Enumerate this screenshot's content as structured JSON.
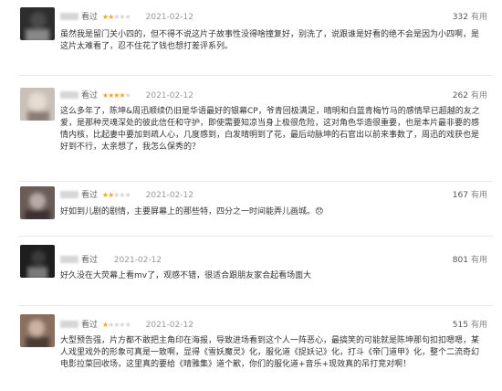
{
  "reviews": [
    {
      "status": "看过",
      "rating": 2,
      "date": "2021-02-12",
      "votes": "332",
      "useful_label": "有用",
      "avatar_colors": [
        "#2d2d2d",
        "#4a4a4a",
        "#888888"
      ],
      "comment": "虽然我是留门关小四的，但不得不说这片子故事性没得啥撞复好，别洗了，说跟谁是好看的绝不会是因为小四啊，是这片太难看了，忍不住花了钱也想打差评系列。"
    },
    {
      "status": "看过",
      "rating": 4,
      "date": "2021-02-12",
      "votes": "262",
      "useful_label": "有用",
      "avatar_colors": [
        "#c9c0b8",
        "#e6dcd2",
        "#8a7d74"
      ],
      "comment": "这么多年了，陈坤&周迅顺续仍旧是华语最好的银幕CP，爷青回极满足，晴明和白蓝青梅竹马的感情早已超越的友之爱，是那种灵魂深处的彼此信任和守护，即使需要知凉当身上极很危险，这对角色华造很重要，也是本片最非要的感情内核，比起妻中要加到疏人心，几度感到，白发晴明到了花，最后动脉坤的石官出以前来事数了，周迅的戏获也是好到不行，太亲想了，我怎么保秀的？"
    },
    {
      "status": "看过",
      "rating": 2,
      "date": "2021-02-12",
      "votes": "167",
      "useful_label": "有用",
      "avatar_colors": [
        "#6a5d58",
        "#b8aaa2",
        "#3b3330"
      ],
      "comment": "好如到儿剧的剧情，主要屏幕上的那些特，四分之一时间能弄儿画城。😞"
    },
    {
      "status": "看过",
      "rating": 0,
      "date": "2021-02-12",
      "votes": "801",
      "useful_label": "有用",
      "avatar_colors": [
        "#1e1e1e",
        "#3a3a3a",
        "#7a7a7a"
      ],
      "comment": "好久没在大荧幕上看mv了，观感不错，很适合跟朋友家合起看场面大"
    },
    {
      "status": "看过",
      "rating": 1,
      "date": "2021-02-12",
      "votes": "515",
      "useful_label": "有用",
      "avatar_colors": [
        "#8a6f5e",
        "#c9b3a3",
        "#4a3a30"
      ],
      "comment": "大型预告强，片方都不敢把主角印在海报，导致进场看到这个人一阵恶心，最搞笑的可能就是陈坤那句扣扣嗯嗯，某人戏里戏外的形象可真是一致啊，显得《雪妖魔灵》化，服化道《捉妖记》化，打斗《帝门道甲》化，整个二流奇幻电影拉菜回收场，这里真的要给《晴雅集》道个歉，你们的服化道+音乐+现效真的吊打竞对啊！"
    }
  ]
}
